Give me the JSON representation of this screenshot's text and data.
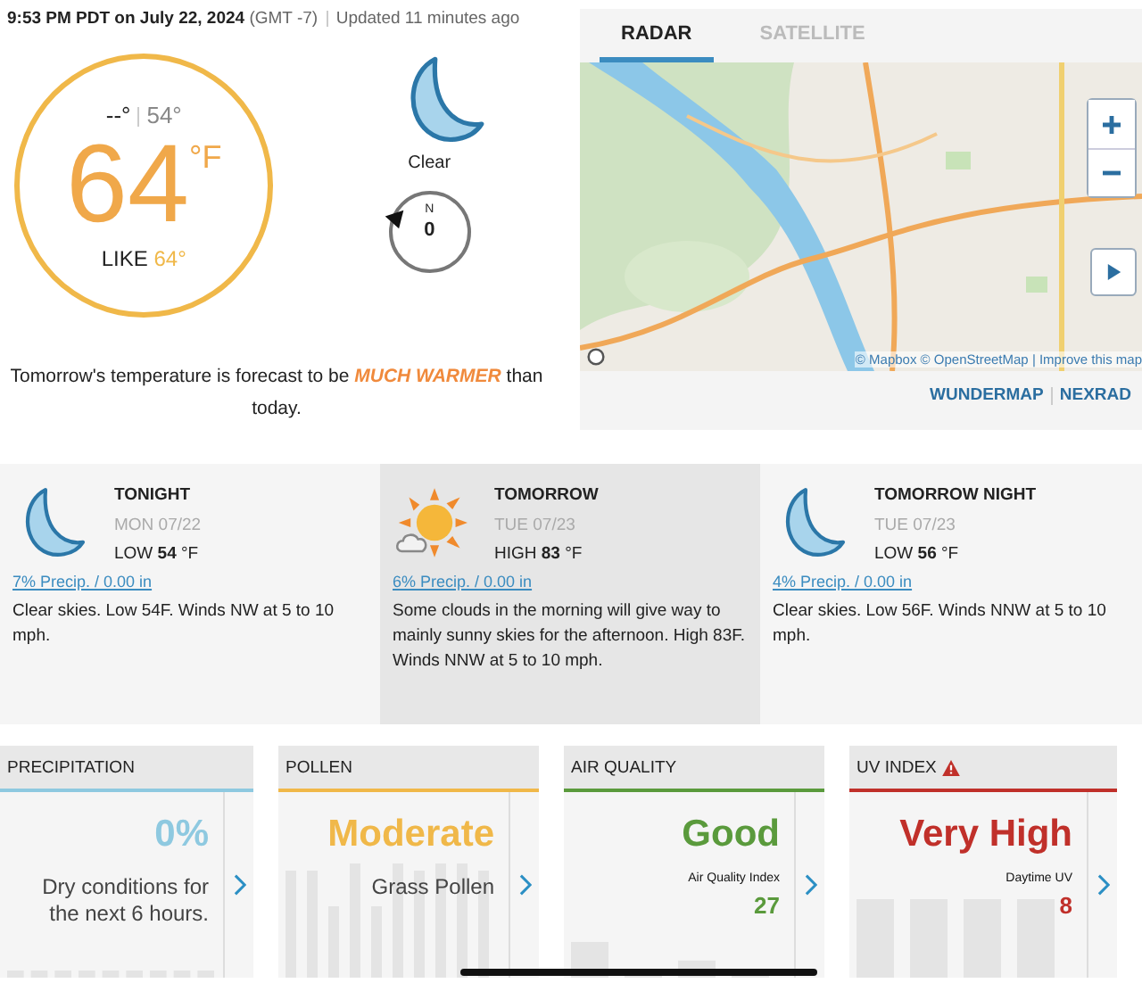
{
  "observation": {
    "time": "9:53 PM PDT on July 22, 2024",
    "zone": "(GMT -7)",
    "updated": "Updated 11 minutes ago"
  },
  "current": {
    "high": "--°",
    "low": "54°",
    "temp": "64",
    "unit": "°F",
    "feels_label": "LIKE",
    "feels": "64°",
    "condition": "Clear",
    "wind_dir": "N",
    "wind_speed": "0"
  },
  "outlook": {
    "before": "Tomorrow's temperature is forecast to be",
    "emphasis": "MUCH WARMER",
    "after": "than today."
  },
  "map": {
    "tabs": [
      {
        "label": "RADAR",
        "selected": true
      },
      {
        "label": "SATELLITE",
        "selected": false
      }
    ],
    "attribution": "© Mapbox © OpenStreetMap | Improve this map",
    "links": [
      "WUNDERMAP",
      "NEXRAD"
    ]
  },
  "forecast": [
    {
      "period": "TONIGHT",
      "date": "MON 07/22",
      "kind": "night",
      "bound": "LOW",
      "temp": "54",
      "unit": "°F",
      "precip": "7% Precip. / 0.00 in",
      "summary": "Clear skies. Low 54F. Winds NW at 5 to 10 mph.",
      "selected": false
    },
    {
      "period": "TOMORROW",
      "date": "TUE 07/23",
      "kind": "partly-sunny",
      "bound": "HIGH",
      "temp": "83",
      "unit": "°F",
      "precip": "6% Precip. / 0.00 in",
      "summary": "Some clouds in the morning will give way to mainly sunny skies for the afternoon. High 83F. Winds NNW at 5 to 10 mph.",
      "selected": true
    },
    {
      "period": "TOMORROW NIGHT",
      "date": "TUE 07/23",
      "kind": "night",
      "bound": "LOW",
      "temp": "56",
      "unit": "°F",
      "precip": "4% Precip. / 0.00 in",
      "summary": "Clear skies. Low 56F. Winds NNW at 5 to 10 mph.",
      "selected": false
    }
  ],
  "indices": [
    {
      "title": "PRECIPITATION",
      "color": "#8ec9e0",
      "value": "0%",
      "label": "Dry conditions for the next 6 hours.",
      "warning": false
    },
    {
      "title": "POLLEN",
      "color": "#f0b849",
      "value": "Moderate",
      "label": "Grass Pollen",
      "warning": false
    },
    {
      "title": "AIR QUALITY",
      "color": "#5a9a3c",
      "value": "Good",
      "label": "Air Quality Index",
      "reading": "27",
      "warning": false
    },
    {
      "title": "UV INDEX",
      "color": "#c0302a",
      "value": "Very High",
      "label": "Daytime UV",
      "reading": "8",
      "warning": true
    }
  ]
}
